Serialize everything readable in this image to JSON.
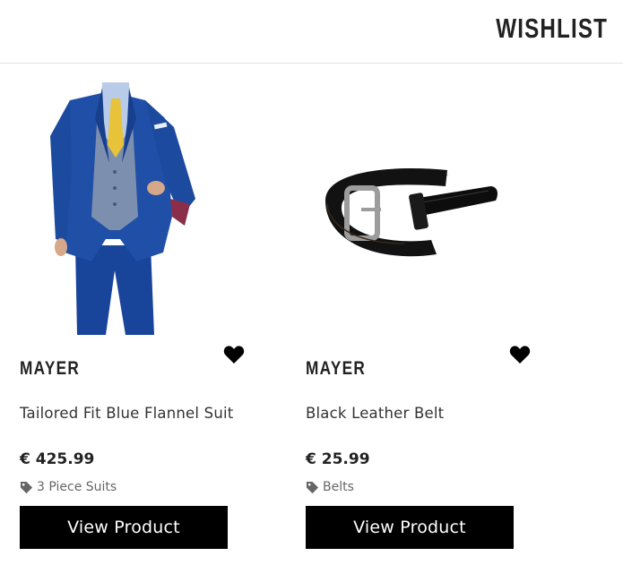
{
  "header": {
    "title": "WISHLIST"
  },
  "products": [
    {
      "image_icon": "suit-image",
      "brand": "MAYER",
      "name": "Tailored Fit Blue Flannel Suit",
      "price": "€ 425.99",
      "category": "3 Piece Suits",
      "button_label": "View Product"
    },
    {
      "image_icon": "belt-image",
      "brand": "MAYER",
      "name": "Black Leather Belt",
      "price": "€ 25.99",
      "category": "Belts",
      "button_label": "View Product"
    }
  ],
  "colors": {
    "button_bg": "#000000",
    "button_text": "#ffffff",
    "divider": "#e2e2e2",
    "suit_blue": "#1f4fa6",
    "waistcoat_grey": "#7d8fae",
    "tie_yellow": "#e8c33a"
  }
}
